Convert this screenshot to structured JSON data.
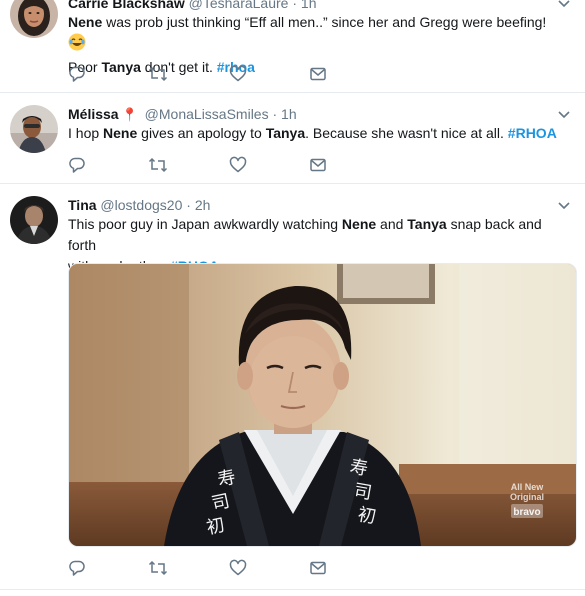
{
  "tweets": [
    {
      "name": "Carrie Blackshaw",
      "handle": "@TesharaLaure",
      "time": "1h",
      "line1_parts": [
        "Nene",
        " was prob just thinking “Eff all men..” since her and Gregg were beefing! "
      ],
      "line2_parts": [
        "Poor ",
        "Tanya",
        " don't get it. ",
        "#rhoa"
      ],
      "emoji": "😂"
    },
    {
      "name": "Mélissa",
      "badge": "📍",
      "handle": "@MonaLissaSmiles",
      "time": "1h",
      "parts": [
        "I hop ",
        "Nene",
        " gives an apology to ",
        "Tanya",
        ". Because she wasn't nice at all. ",
        "#RHOA"
      ]
    },
    {
      "name": "Tina",
      "handle": "@lostdogs20",
      "time": "2h",
      "line1_parts": [
        "This poor guy in Japan awkwardly watching ",
        "Nene",
        " and ",
        "Tanya",
        " snap back and forth"
      ],
      "line2_parts": [
        "with each other. ",
        "#RHOA"
      ],
      "media": {
        "watermark_line1": "All New",
        "watermark_line2": "Original",
        "watermark_brand": "bravo",
        "uniform_text": "寿司初"
      }
    }
  ],
  "actions": [
    "reply-icon",
    "retweet-icon",
    "like-icon",
    "message-icon"
  ],
  "colors": {
    "hashtag": "#1b95e0",
    "muted": "#657786",
    "border": "#e6ecf0",
    "icon": "#657786"
  }
}
